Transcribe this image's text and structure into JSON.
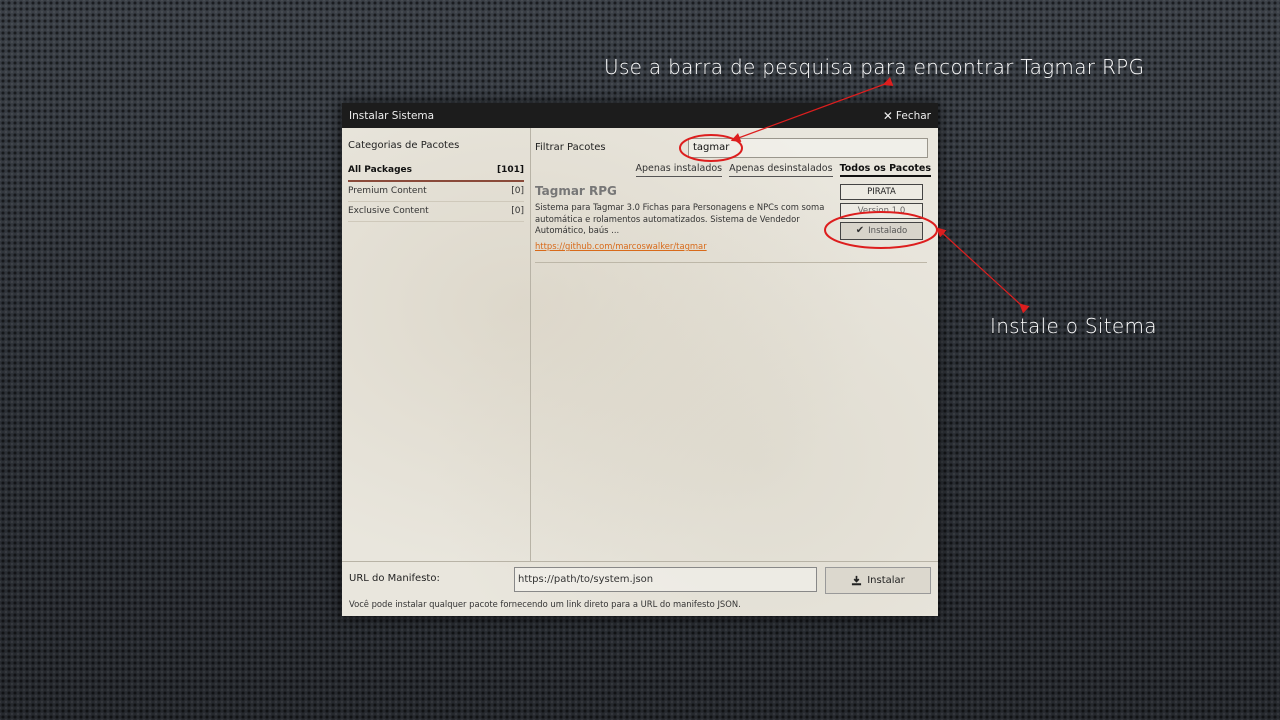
{
  "annotations": {
    "top": "Use a barra de pesquisa para encontrar Tagmar RPG",
    "right": "Instale o Sitema"
  },
  "colors": {
    "annotation_red": "#dd1e1e",
    "link_orange": "#d86a1a",
    "titlebar_bg": "#1c1c1c"
  },
  "dialog": {
    "title": "Instalar Sistema",
    "close_label": "Fechar",
    "categories": {
      "title": "Categorias de Pacotes",
      "items": [
        {
          "label": "All Packages",
          "count": "[101]"
        },
        {
          "label": "Premium Content",
          "count": "[0]"
        },
        {
          "label": "Exclusive Content",
          "count": "[0]"
        }
      ]
    },
    "filter": {
      "label": "Filtrar Pacotes",
      "value": "tagmar"
    },
    "tabs": [
      "Apenas instalados",
      "Apenas desinstalados",
      "Todos os Pacotes"
    ],
    "package": {
      "title": "Tagmar RPG",
      "description": "Sistema para Tagmar 3.0 Fichas para Personagens e NPCs com soma automática e rolamentos automatizados. Sistema de Vendedor Automático, baús ...",
      "url": "https://github.com/marcoswalker/tagmar",
      "tag": "PIRATA",
      "version": "Version 1.0",
      "status": "Instalado"
    },
    "manifest": {
      "label": "URL do Manifesto:",
      "placeholder": "https://path/to/system.json",
      "install_label": "Instalar",
      "note": "Você pode instalar qualquer pacote fornecendo um link direto para a URL do manifesto JSON."
    }
  }
}
